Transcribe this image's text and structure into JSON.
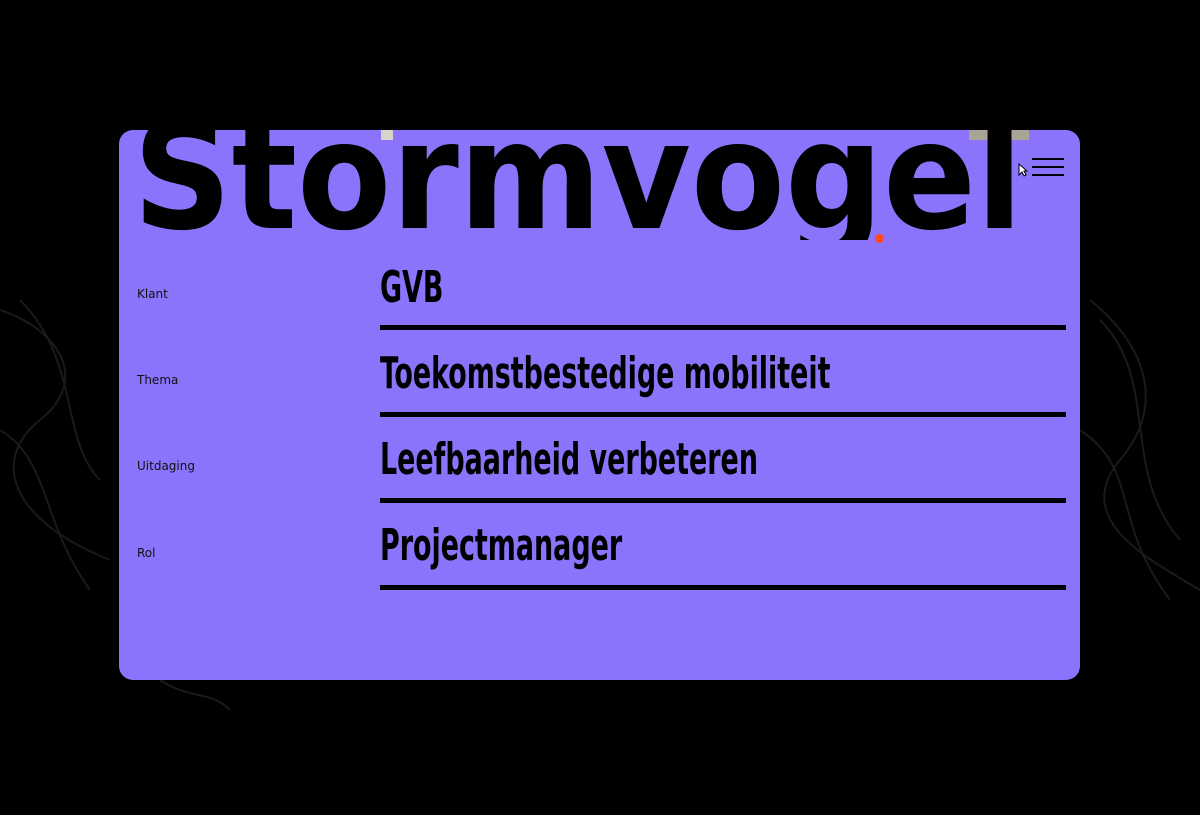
{
  "site": {
    "logo_text": "Stormvogel",
    "menu_icon": "hamburger-menu-icon",
    "accent": "#ff4a1c",
    "panel_color": "#8b74fb",
    "background": "#000000"
  },
  "details": [
    {
      "label": "Klant",
      "value": "GVB"
    },
    {
      "label": "Thema",
      "value": "Toekomstbestedige mobiliteit"
    },
    {
      "label": "Uitdaging",
      "value": "Leefbaarheid verbeteren"
    },
    {
      "label": "Rol",
      "value": "Projectmanager"
    }
  ]
}
